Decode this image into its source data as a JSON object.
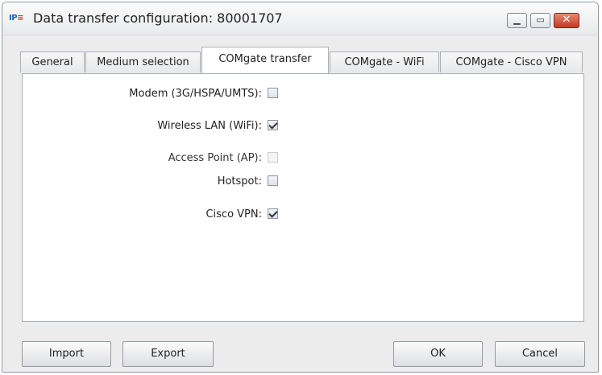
{
  "window": {
    "title": "Data transfer configuration: 80001707",
    "app_icon": "IPE",
    "controls": {
      "minimize": "minimize-icon",
      "maximize": "maximize-icon",
      "close": "close-icon"
    }
  },
  "tabs": [
    {
      "label": "General",
      "active": false
    },
    {
      "label": "Medium selection",
      "active": false
    },
    {
      "label": "COMgate transfer",
      "active": true
    },
    {
      "label": "COMgate - WiFi",
      "active": false
    },
    {
      "label": "COMgate - Cisco VPN",
      "active": false
    }
  ],
  "options": [
    {
      "label": "Modem (3G/HSPA/UMTS):",
      "checked": false,
      "enabled": true
    },
    {
      "label": "Wireless LAN (WiFi):",
      "checked": true,
      "enabled": true
    },
    {
      "label": "Access Point (AP):",
      "checked": false,
      "enabled": false
    },
    {
      "label": "Hotspot:",
      "checked": false,
      "enabled": true
    },
    {
      "label": "Cisco VPN:",
      "checked": true,
      "enabled": true
    }
  ],
  "buttons": {
    "import": "Import",
    "export": "Export",
    "ok": "OK",
    "cancel": "Cancel"
  },
  "colors": {
    "close_button": "#c53a23",
    "window_bg": "#ececec",
    "panel_bg": "#ffffff"
  }
}
